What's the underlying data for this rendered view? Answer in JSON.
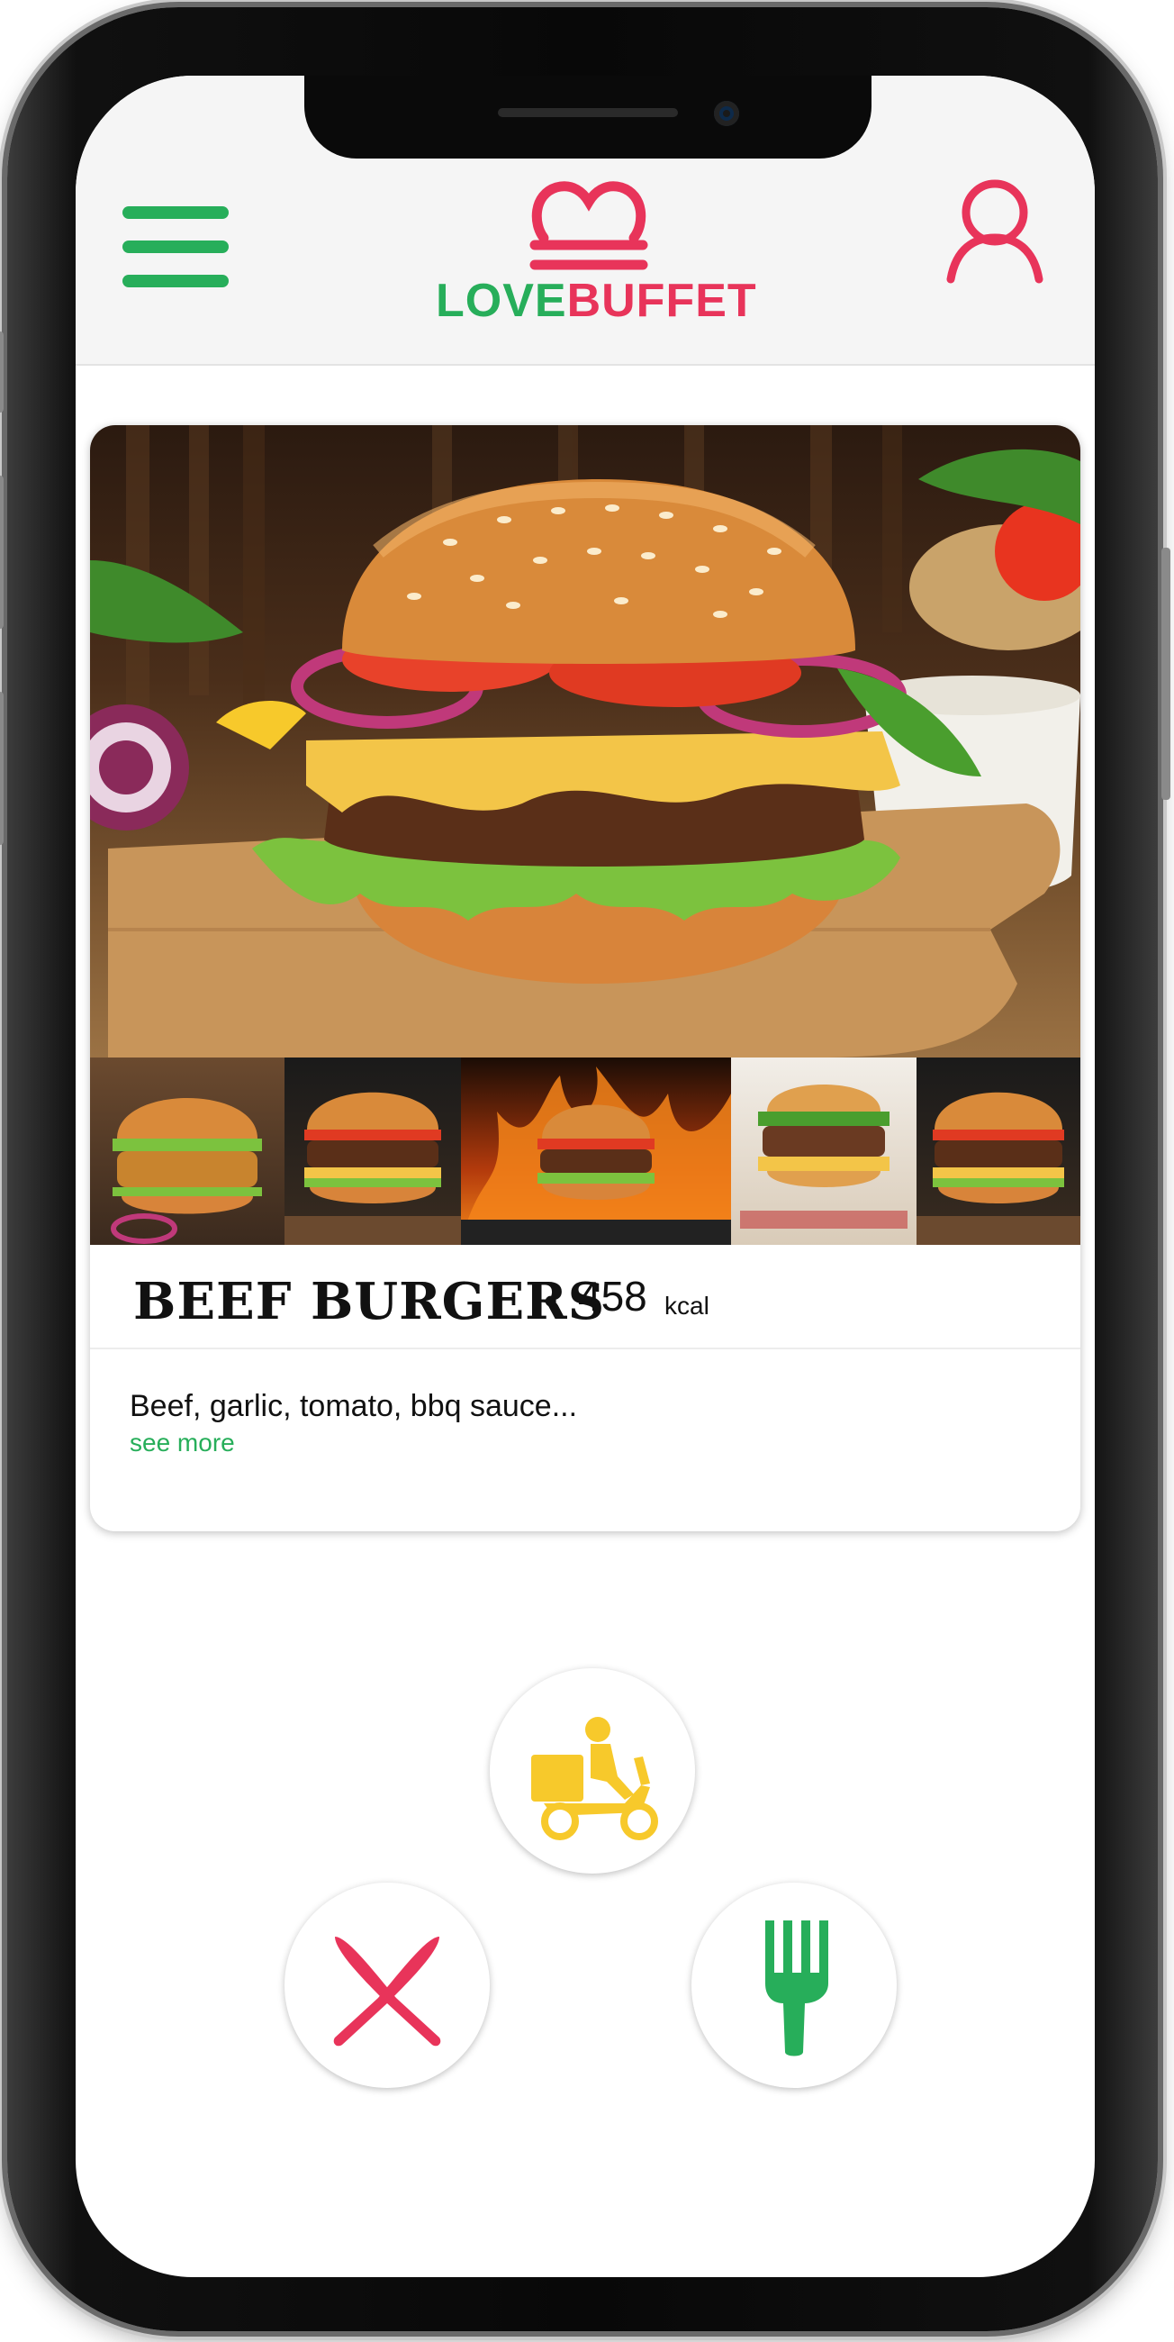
{
  "header": {
    "logo_love": "LOVE",
    "logo_buffet": "BUFFET"
  },
  "dish": {
    "name": "BEEF BURGERS",
    "separator": "•",
    "kcal_value": "458",
    "kcal_unit": "kcal",
    "description": "Beef, garlic, tomato, bbq sauce...",
    "see_more": "see more"
  },
  "thumbnails": [
    {
      "name": "thumbnail-crispy-chicken-burger"
    },
    {
      "name": "thumbnail-cheeseburger"
    },
    {
      "name": "thumbnail-flame-burger"
    },
    {
      "name": "thumbnail-gourmet-burger"
    },
    {
      "name": "thumbnail-classic-burger"
    }
  ],
  "actions": {
    "delivery_icon": "delivery-scooter-icon",
    "reject_icon": "cross-icon",
    "accept_icon": "fork-icon"
  },
  "colors": {
    "brand_green": "#27ae5a",
    "brand_red": "#e8345a",
    "delivery_yellow": "#f7c92b"
  }
}
